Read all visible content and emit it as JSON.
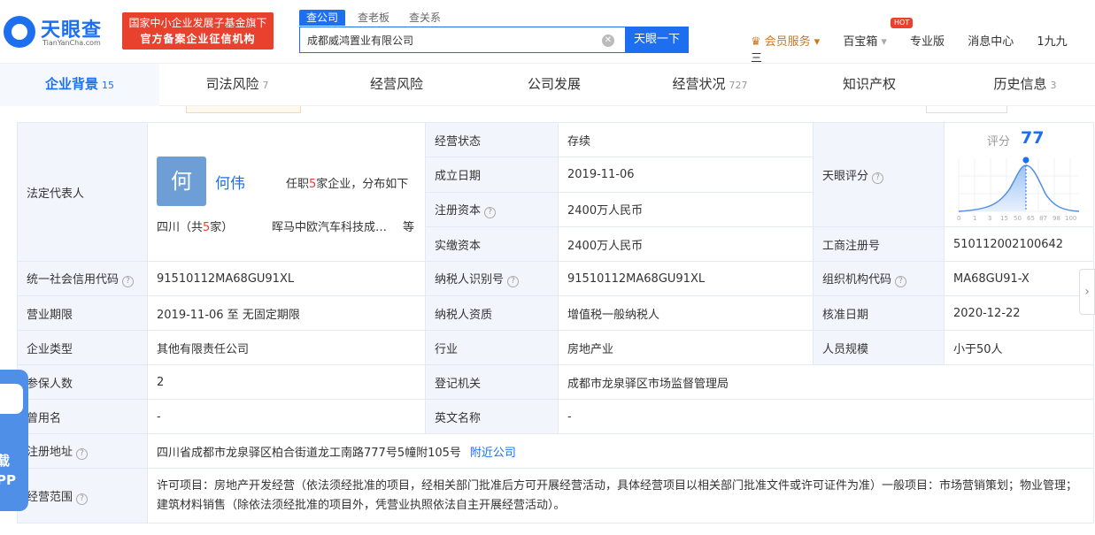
{
  "header": {
    "logo_text": "天眼查",
    "logo_sub": "TianYanCha.com",
    "gov_badge_line1": "国家中小企业发展子基金旗下",
    "gov_badge_line2": "官方备案企业征信机构",
    "search_tabs": [
      "查公司",
      "查老板",
      "查关系"
    ],
    "search_value": "成都威鸿置业有限公司",
    "search_button": "天眼一下",
    "nav": {
      "vip": "会员服务",
      "treasure": "百宝箱",
      "hot": "HOT",
      "pro": "专业版",
      "messages": "消息中心",
      "user": "1九九三"
    }
  },
  "tabs": [
    {
      "label": "企业背景",
      "count": "15"
    },
    {
      "label": "司法风险",
      "count": "7"
    },
    {
      "label": "经营风险",
      "count": ""
    },
    {
      "label": "公司发展",
      "count": ""
    },
    {
      "label": "经营状况",
      "count": "727"
    },
    {
      "label": "知识产权",
      "count": ""
    },
    {
      "label": "历史信息",
      "count": "3"
    }
  ],
  "info": {
    "legal_rep_label": "法定代表人",
    "rep_avatar": "何",
    "rep_name": "何伟",
    "rep_positions_pre": "任职",
    "rep_positions_num": "5",
    "rep_positions_post": "家企业，分布如下",
    "rep_region_pre": "四川（共",
    "rep_region_num": "5",
    "rep_region_post": "家）",
    "rep_company": "晖马中欧汽车科技成…",
    "rep_etc": "等",
    "status_label": "经营状态",
    "status_value": "存续",
    "founded_label": "成立日期",
    "founded_value": "2019-11-06",
    "reg_capital_label": "注册资本",
    "reg_capital_value": "2400万人民币",
    "paid_capital_label": "实缴资本",
    "paid_capital_value": "2400万人民币",
    "score_label_cell": "天眼评分",
    "score_label": "评分",
    "score_value": "77",
    "score_axis": [
      "0",
      "1",
      "3",
      "15",
      "50",
      "65",
      "87",
      "98",
      "100"
    ],
    "biz_reg_label": "工商注册号",
    "biz_reg_value": "510112002100642",
    "credit_code_label": "统一社会信用代码",
    "credit_code_value": "91510112MA68GU91XL",
    "taxpayer_id_label": "纳税人识别号",
    "taxpayer_id_value": "91510112MA68GU91XL",
    "org_code_label": "组织机构代码",
    "org_code_value": "MA68GU91-X",
    "period_label": "营业期限",
    "period_value": "2019-11-06 至 无固定期限",
    "taxpayer_type_label": "纳税人资质",
    "taxpayer_type_value": "增值税一般纳税人",
    "approval_label": "核准日期",
    "approval_value": "2020-12-22",
    "type_label": "企业类型",
    "type_value": "其他有限责任公司",
    "industry_label": "行业",
    "industry_value": "房地产业",
    "staff_label": "人员规模",
    "staff_value": "小于50人",
    "insured_label": "参保人数",
    "insured_value": "2",
    "authority_label": "登记机关",
    "authority_value": "成都市龙泉驿区市场监督管理局",
    "former_label": "曾用名",
    "former_value": "-",
    "english_label": "英文名称",
    "english_value": "-",
    "address_label": "注册地址",
    "address_value": "四川省成都市龙泉驿区柏合街道龙工南路777号5幢附105号",
    "nearby": "附近公司",
    "scope_label": "经营范围",
    "scope_value": "许可项目：房地产开发经营（依法须经批准的项目，经相关部门批准后方可开展经营活动，具体经营项目以相关部门批准文件或许可证件为准）一般项目：市场营销策划；物业管理；建筑材料销售（除依法须经批准的项目外，凭营业执照依法自主开展经营活动）。"
  },
  "float_app_text_1": "载",
  "float_app_text_2": "PP",
  "colors": {
    "brand": "#1d6ff0",
    "danger": "#e8422f",
    "label_bg": "#f2f6fc"
  }
}
